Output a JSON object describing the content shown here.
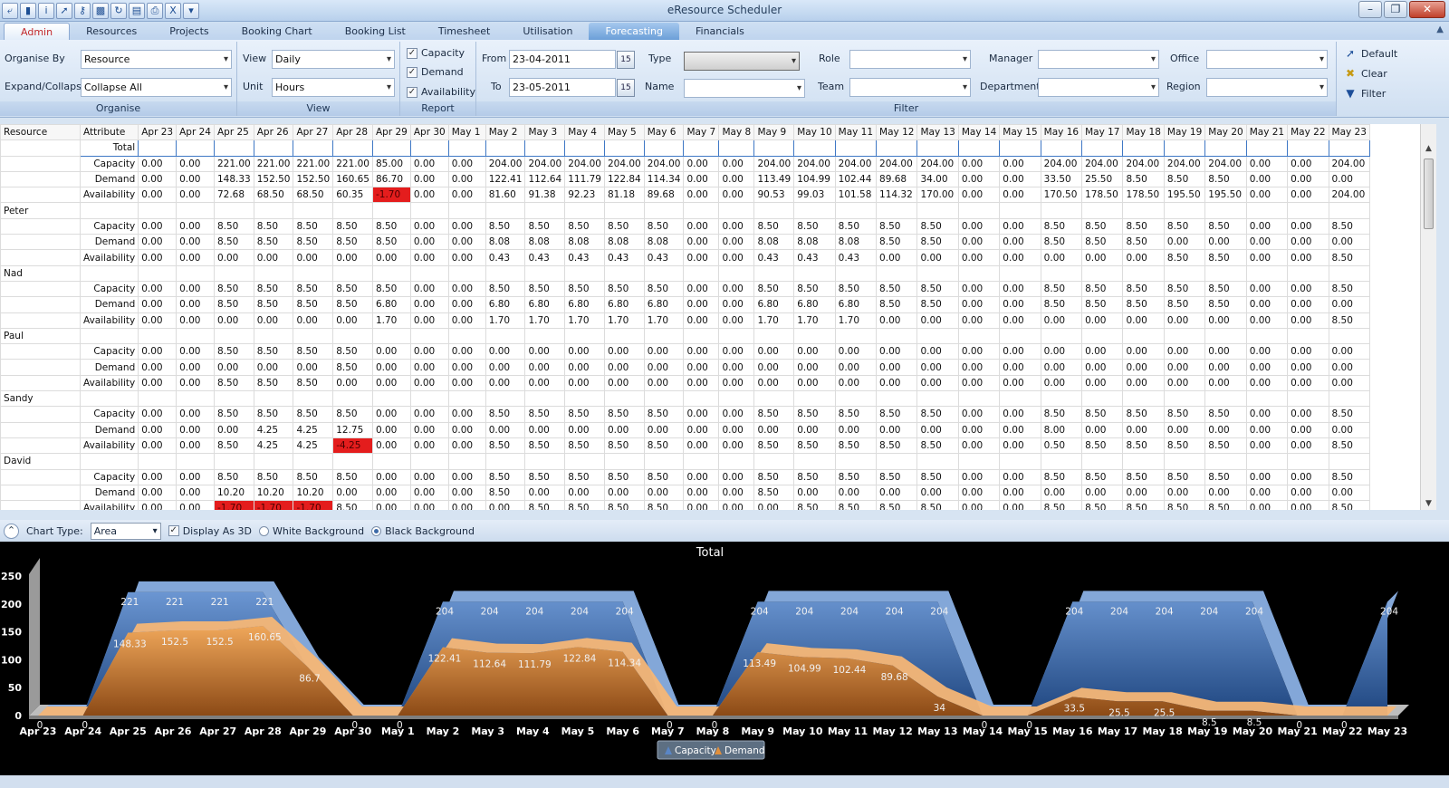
{
  "app": {
    "title": "eResource Scheduler"
  },
  "tabs": [
    "Admin",
    "Resources",
    "Projects",
    "Booking Chart",
    "Booking List",
    "Timesheet",
    "Utilisation",
    "Forecasting",
    "Financials"
  ],
  "active_tab": "Forecasting",
  "ribbon": {
    "organise": {
      "group_title": "Organise",
      "organise_by_label": "Organise By",
      "organise_by_value": "Resource",
      "expand_label": "Expand/Collapse",
      "expand_value": "Collapse All"
    },
    "view": {
      "group_title": "View",
      "view_label": "View",
      "view_value": "Daily",
      "unit_label": "Unit",
      "unit_value": "Hours"
    },
    "report": {
      "group_title": "Report",
      "capacity": "Capacity",
      "demand": "Demand",
      "availability": "Availability"
    },
    "filter": {
      "group_title": "Filter",
      "from_label": "From",
      "from_value": "23-04-2011",
      "to_label": "To",
      "to_value": "23-05-2011",
      "cal_label": "15",
      "type_label": "Type",
      "name_label": "Name",
      "role_label": "Role",
      "team_label": "Team",
      "manager_label": "Manager",
      "department_label": "Department",
      "office_label": "Office",
      "region_label": "Region"
    },
    "actions": {
      "default": "Default",
      "clear": "Clear",
      "filter": "Filter"
    }
  },
  "grid": {
    "col_resource": "Resource",
    "col_attribute": "Attribute",
    "total_label": "Total",
    "dates": [
      "Apr 23",
      "Apr 24",
      "Apr 25",
      "Apr 26",
      "Apr 27",
      "Apr 28",
      "Apr 29",
      "Apr 30",
      "May 1",
      "May 2",
      "May 3",
      "May 4",
      "May 5",
      "May 6",
      "May 7",
      "May 8",
      "May 9",
      "May 10",
      "May 11",
      "May 12",
      "May 13",
      "May 14",
      "May 15",
      "May 16",
      "May 17",
      "May 18",
      "May 19",
      "May 20",
      "May 21",
      "May 22",
      "May 23"
    ],
    "groups": [
      {
        "resource": "",
        "rows": [
          {
            "attr": "Capacity",
            "values": [
              "0.00",
              "0.00",
              "221.00",
              "221.00",
              "221.00",
              "221.00",
              "85.00",
              "0.00",
              "0.00",
              "204.00",
              "204.00",
              "204.00",
              "204.00",
              "204.00",
              "0.00",
              "0.00",
              "204.00",
              "204.00",
              "204.00",
              "204.00",
              "204.00",
              "0.00",
              "0.00",
              "204.00",
              "204.00",
              "204.00",
              "204.00",
              "204.00",
              "0.00",
              "0.00",
              "204.00"
            ]
          },
          {
            "attr": "Demand",
            "values": [
              "0.00",
              "0.00",
              "148.33",
              "152.50",
              "152.50",
              "160.65",
              "86.70",
              "0.00",
              "0.00",
              "122.41",
              "112.64",
              "111.79",
              "122.84",
              "114.34",
              "0.00",
              "0.00",
              "113.49",
              "104.99",
              "102.44",
              "89.68",
              "34.00",
              "0.00",
              "0.00",
              "33.50",
              "25.50",
              "8.50",
              "8.50",
              "8.50",
              "0.00",
              "0.00",
              "0.00"
            ]
          },
          {
            "attr": "Availability",
            "values": [
              "0.00",
              "0.00",
              "72.68",
              "68.50",
              "68.50",
              "60.35",
              "-1.70",
              "0.00",
              "0.00",
              "81.60",
              "91.38",
              "92.23",
              "81.18",
              "89.68",
              "0.00",
              "0.00",
              "90.53",
              "99.03",
              "101.58",
              "114.32",
              "170.00",
              "0.00",
              "0.00",
              "170.50",
              "178.50",
              "178.50",
              "195.50",
              "195.50",
              "0.00",
              "0.00",
              "204.00"
            ]
          }
        ]
      },
      {
        "resource": "Peter",
        "rows": [
          {
            "attr": "Capacity",
            "values": [
              "0.00",
              "0.00",
              "8.50",
              "8.50",
              "8.50",
              "8.50",
              "8.50",
              "0.00",
              "0.00",
              "8.50",
              "8.50",
              "8.50",
              "8.50",
              "8.50",
              "0.00",
              "0.00",
              "8.50",
              "8.50",
              "8.50",
              "8.50",
              "8.50",
              "0.00",
              "0.00",
              "8.50",
              "8.50",
              "8.50",
              "8.50",
              "8.50",
              "0.00",
              "0.00",
              "8.50"
            ]
          },
          {
            "attr": "Demand",
            "values": [
              "0.00",
              "0.00",
              "8.50",
              "8.50",
              "8.50",
              "8.50",
              "8.50",
              "0.00",
              "0.00",
              "8.08",
              "8.08",
              "8.08",
              "8.08",
              "8.08",
              "0.00",
              "0.00",
              "8.08",
              "8.08",
              "8.08",
              "8.50",
              "8.50",
              "0.00",
              "0.00",
              "8.50",
              "8.50",
              "8.50",
              "0.00",
              "0.00",
              "0.00",
              "0.00",
              "0.00"
            ]
          },
          {
            "attr": "Availability",
            "values": [
              "0.00",
              "0.00",
              "0.00",
              "0.00",
              "0.00",
              "0.00",
              "0.00",
              "0.00",
              "0.00",
              "0.43",
              "0.43",
              "0.43",
              "0.43",
              "0.43",
              "0.00",
              "0.00",
              "0.43",
              "0.43",
              "0.43",
              "0.00",
              "0.00",
              "0.00",
              "0.00",
              "0.00",
              "0.00",
              "0.00",
              "8.50",
              "8.50",
              "0.00",
              "0.00",
              "8.50"
            ]
          }
        ]
      },
      {
        "resource": "Nad",
        "rows": [
          {
            "attr": "Capacity",
            "values": [
              "0.00",
              "0.00",
              "8.50",
              "8.50",
              "8.50",
              "8.50",
              "8.50",
              "0.00",
              "0.00",
              "8.50",
              "8.50",
              "8.50",
              "8.50",
              "8.50",
              "0.00",
              "0.00",
              "8.50",
              "8.50",
              "8.50",
              "8.50",
              "8.50",
              "0.00",
              "0.00",
              "8.50",
              "8.50",
              "8.50",
              "8.50",
              "8.50",
              "0.00",
              "0.00",
              "8.50"
            ]
          },
          {
            "attr": "Demand",
            "values": [
              "0.00",
              "0.00",
              "8.50",
              "8.50",
              "8.50",
              "8.50",
              "6.80",
              "0.00",
              "0.00",
              "6.80",
              "6.80",
              "6.80",
              "6.80",
              "6.80",
              "0.00",
              "0.00",
              "6.80",
              "6.80",
              "6.80",
              "8.50",
              "8.50",
              "0.00",
              "0.00",
              "8.50",
              "8.50",
              "8.50",
              "8.50",
              "8.50",
              "0.00",
              "0.00",
              "0.00"
            ]
          },
          {
            "attr": "Availability",
            "values": [
              "0.00",
              "0.00",
              "0.00",
              "0.00",
              "0.00",
              "0.00",
              "1.70",
              "0.00",
              "0.00",
              "1.70",
              "1.70",
              "1.70",
              "1.70",
              "1.70",
              "0.00",
              "0.00",
              "1.70",
              "1.70",
              "1.70",
              "0.00",
              "0.00",
              "0.00",
              "0.00",
              "0.00",
              "0.00",
              "0.00",
              "0.00",
              "0.00",
              "0.00",
              "0.00",
              "8.50"
            ]
          }
        ]
      },
      {
        "resource": "Paul",
        "rows": [
          {
            "attr": "Capacity",
            "values": [
              "0.00",
              "0.00",
              "8.50",
              "8.50",
              "8.50",
              "8.50",
              "0.00",
              "0.00",
              "0.00",
              "0.00",
              "0.00",
              "0.00",
              "0.00",
              "0.00",
              "0.00",
              "0.00",
              "0.00",
              "0.00",
              "0.00",
              "0.00",
              "0.00",
              "0.00",
              "0.00",
              "0.00",
              "0.00",
              "0.00",
              "0.00",
              "0.00",
              "0.00",
              "0.00",
              "0.00"
            ]
          },
          {
            "attr": "Demand",
            "values": [
              "0.00",
              "0.00",
              "0.00",
              "0.00",
              "0.00",
              "8.50",
              "0.00",
              "0.00",
              "0.00",
              "0.00",
              "0.00",
              "0.00",
              "0.00",
              "0.00",
              "0.00",
              "0.00",
              "0.00",
              "0.00",
              "0.00",
              "0.00",
              "0.00",
              "0.00",
              "0.00",
              "0.00",
              "0.00",
              "0.00",
              "0.00",
              "0.00",
              "0.00",
              "0.00",
              "0.00"
            ]
          },
          {
            "attr": "Availability",
            "values": [
              "0.00",
              "0.00",
              "8.50",
              "8.50",
              "8.50",
              "0.00",
              "0.00",
              "0.00",
              "0.00",
              "0.00",
              "0.00",
              "0.00",
              "0.00",
              "0.00",
              "0.00",
              "0.00",
              "0.00",
              "0.00",
              "0.00",
              "0.00",
              "0.00",
              "0.00",
              "0.00",
              "0.00",
              "0.00",
              "0.00",
              "0.00",
              "0.00",
              "0.00",
              "0.00",
              "0.00"
            ]
          }
        ]
      },
      {
        "resource": "Sandy",
        "rows": [
          {
            "attr": "Capacity",
            "values": [
              "0.00",
              "0.00",
              "8.50",
              "8.50",
              "8.50",
              "8.50",
              "0.00",
              "0.00",
              "0.00",
              "8.50",
              "8.50",
              "8.50",
              "8.50",
              "8.50",
              "0.00",
              "0.00",
              "8.50",
              "8.50",
              "8.50",
              "8.50",
              "8.50",
              "0.00",
              "0.00",
              "8.50",
              "8.50",
              "8.50",
              "8.50",
              "8.50",
              "0.00",
              "0.00",
              "8.50"
            ]
          },
          {
            "attr": "Demand",
            "values": [
              "0.00",
              "0.00",
              "0.00",
              "4.25",
              "4.25",
              "12.75",
              "0.00",
              "0.00",
              "0.00",
              "0.00",
              "0.00",
              "0.00",
              "0.00",
              "0.00",
              "0.00",
              "0.00",
              "0.00",
              "0.00",
              "0.00",
              "0.00",
              "0.00",
              "0.00",
              "0.00",
              "8.00",
              "0.00",
              "0.00",
              "0.00",
              "0.00",
              "0.00",
              "0.00",
              "0.00"
            ]
          },
          {
            "attr": "Availability",
            "values": [
              "0.00",
              "0.00",
              "8.50",
              "4.25",
              "4.25",
              "-4.25",
              "0.00",
              "0.00",
              "0.00",
              "8.50",
              "8.50",
              "8.50",
              "8.50",
              "8.50",
              "0.00",
              "0.00",
              "8.50",
              "8.50",
              "8.50",
              "8.50",
              "8.50",
              "0.00",
              "0.00",
              "0.50",
              "8.50",
              "8.50",
              "8.50",
              "8.50",
              "0.00",
              "0.00",
              "8.50"
            ]
          }
        ]
      },
      {
        "resource": "David",
        "rows": [
          {
            "attr": "Capacity",
            "values": [
              "0.00",
              "0.00",
              "8.50",
              "8.50",
              "8.50",
              "8.50",
              "0.00",
              "0.00",
              "0.00",
              "8.50",
              "8.50",
              "8.50",
              "8.50",
              "8.50",
              "0.00",
              "0.00",
              "8.50",
              "8.50",
              "8.50",
              "8.50",
              "8.50",
              "0.00",
              "0.00",
              "8.50",
              "8.50",
              "8.50",
              "8.50",
              "8.50",
              "0.00",
              "0.00",
              "8.50"
            ]
          },
          {
            "attr": "Demand",
            "values": [
              "0.00",
              "0.00",
              "10.20",
              "10.20",
              "10.20",
              "0.00",
              "0.00",
              "0.00",
              "0.00",
              "8.50",
              "0.00",
              "0.00",
              "0.00",
              "0.00",
              "0.00",
              "0.00",
              "8.50",
              "0.00",
              "0.00",
              "0.00",
              "0.00",
              "0.00",
              "0.00",
              "0.00",
              "0.00",
              "0.00",
              "0.00",
              "0.00",
              "0.00",
              "0.00",
              "0.00"
            ]
          },
          {
            "attr": "Availability",
            "values": [
              "0.00",
              "0.00",
              "-1.70",
              "-1.70",
              "-1.70",
              "8.50",
              "0.00",
              "0.00",
              "0.00",
              "0.00",
              "8.50",
              "8.50",
              "8.50",
              "8.50",
              "0.00",
              "0.00",
              "0.00",
              "8.50",
              "8.50",
              "8.50",
              "8.50",
              "0.00",
              "0.00",
              "8.50",
              "8.50",
              "8.50",
              "8.50",
              "8.50",
              "0.00",
              "0.00",
              "8.50"
            ]
          }
        ]
      }
    ]
  },
  "chart_bar": {
    "chart_type_label": "Chart Type:",
    "chart_type_value": "Area",
    "display_3d": "Display As 3D",
    "white_bg": "White Background",
    "black_bg": "Black Background"
  },
  "colors": {
    "capacity": "#5a86c6",
    "demand": "#e08f3c",
    "negative": "#e41d1d",
    "chart_bg": "#000000"
  },
  "chart_data": {
    "type": "area",
    "title": "Total",
    "x": [
      "Apr 23",
      "Apr 24",
      "Apr 25",
      "Apr 26",
      "Apr 27",
      "Apr 28",
      "Apr 29",
      "Apr 30",
      "May 1",
      "May 2",
      "May 3",
      "May 4",
      "May 5",
      "May 6",
      "May 7",
      "May 8",
      "May 9",
      "May 10",
      "May 11",
      "May 12",
      "May 13",
      "May 14",
      "May 15",
      "May 16",
      "May 17",
      "May 18",
      "May 19",
      "May 20",
      "May 21",
      "May 22",
      "May 23"
    ],
    "ylim": [
      0,
      250
    ],
    "yticks": [
      0,
      50,
      100,
      150,
      200,
      250
    ],
    "series": [
      {
        "name": "Capacity",
        "values": [
          0,
          0,
          221,
          221,
          221,
          221,
          85,
          0,
          0,
          204,
          204,
          204,
          204,
          204,
          0,
          0,
          204,
          204,
          204,
          204,
          204,
          0,
          0,
          204,
          204,
          204,
          204,
          204,
          0,
          0,
          204
        ],
        "labels": [
          "0",
          "0",
          "221",
          "221",
          "221",
          "221",
          "",
          "0",
          "0",
          "204",
          "204",
          "204",
          "204",
          "204",
          "0",
          "0",
          "204",
          "204",
          "204",
          "204",
          "204",
          "0",
          "0",
          "204",
          "204",
          "204",
          "204",
          "204",
          "0",
          "0",
          "204"
        ]
      },
      {
        "name": "Demand",
        "values": [
          0,
          0,
          148.33,
          152.5,
          152.5,
          160.65,
          86.7,
          0,
          0,
          122.41,
          112.64,
          111.79,
          122.84,
          114.34,
          0,
          0,
          113.49,
          104.99,
          102.44,
          89.68,
          34,
          0,
          0,
          33.5,
          25.5,
          25.5,
          8.5,
          8.5,
          0,
          0,
          0
        ],
        "labels": [
          "",
          "",
          "148.33",
          "152.5",
          "152.5",
          "160.65",
          "86.7",
          "",
          "",
          "122.41",
          "112.64",
          "111.79",
          "122.84",
          "114.34",
          "",
          "",
          "113.49",
          "104.99",
          "102.44",
          "89.68",
          "34",
          "",
          "",
          "33.5",
          "25.5",
          "25.5",
          "8.5",
          "8.5",
          "",
          "",
          ""
        ]
      }
    ],
    "legend": "bottom-center",
    "display_3d": true
  }
}
